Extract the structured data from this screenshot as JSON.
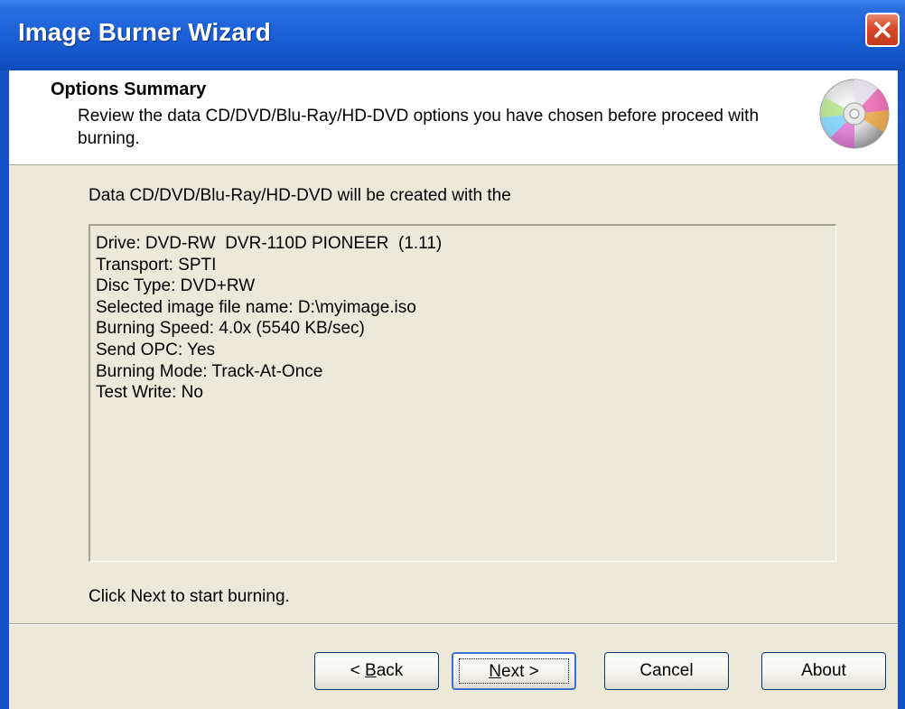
{
  "window": {
    "title": "Image Burner Wizard"
  },
  "header": {
    "title": "Options Summary",
    "subtitle": "Review the data CD/DVD/Blu-Ray/HD-DVD options you have chosen before proceed with burning."
  },
  "intro_text": "Data CD/DVD/Blu-Ray/HD-DVD will be created with the",
  "summary_lines": [
    "Drive: DVD-RW  DVR-110D PIONEER  (1.11)",
    "Transport: SPTI",
    "Disc Type: DVD+RW",
    "Selected image file name: D:\\myimage.iso",
    "Burning Speed: 4.0x (5540 KB/sec)",
    "Send OPC: Yes",
    "Burning Mode: Track-At-Once",
    "Test Write: No"
  ],
  "footer_text": "Click Next to start burning.",
  "buttons": {
    "back": {
      "prefix": "< ",
      "mnemonic": "B",
      "rest": "ack"
    },
    "next": {
      "mnemonic": "N",
      "rest": "ext >"
    },
    "cancel": "Cancel",
    "about": "About"
  },
  "colors": {
    "title_bar": "#1b5fd6",
    "close_button": "#d6492a",
    "dialog_bg": "#ece9d8"
  },
  "icons": {
    "header": "cd-disc-icon",
    "close": "close-icon"
  }
}
